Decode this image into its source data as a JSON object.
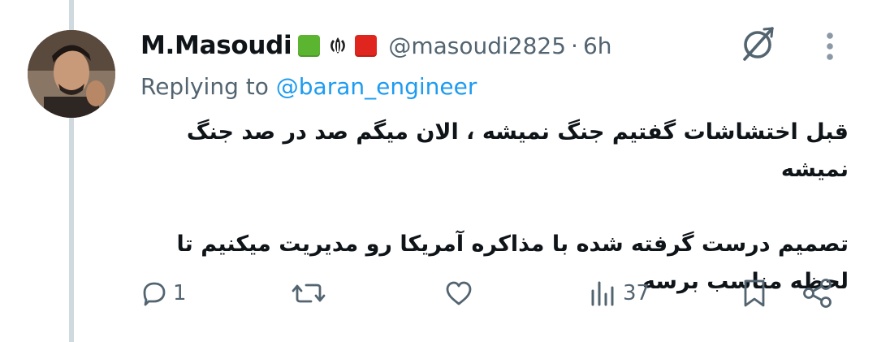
{
  "tweet": {
    "display_name": "M.Masoudi",
    "badges": [
      "green-square-emoji",
      "iran-emblem-emoji",
      "red-square-emoji"
    ],
    "handle": "@masoudi2825",
    "separator": "·",
    "time": "6h",
    "replying_prefix": "Replying to ",
    "replying_to": "@baran_engineer",
    "text": "قبل اختشاشات گفتیم جنگ نمیشه ، الان میگم صد در صد جنگ نمیشه\n\nتصمیم درست گرفته شده با مذاکره آمریکا رو مدیریت میکنیم تا لحظه مناسب برسه",
    "actions": {
      "reply_count": "1",
      "retweet_count": "",
      "like_count": "",
      "views_count": "37"
    }
  },
  "icons": {
    "avatar": "user-avatar",
    "grok": "grok-icon",
    "more": "more-vertical-icon",
    "reply": "reply-icon",
    "retweet": "retweet-icon",
    "like": "heart-icon",
    "views": "analytics-icon",
    "bookmark": "bookmark-icon",
    "share": "share-icon"
  },
  "colors": {
    "link": "#1d9bf0",
    "secondary_text": "#536471",
    "primary_text": "#0f1419",
    "thread_line": "#cfd9de"
  }
}
